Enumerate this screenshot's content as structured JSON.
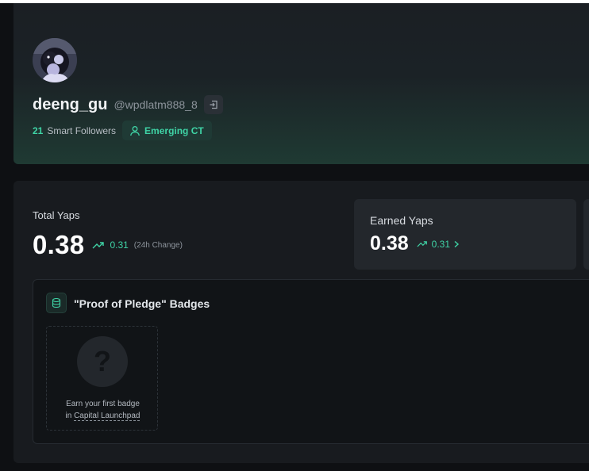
{
  "profile": {
    "display_name": "deeng_gu",
    "handle": "@wpdlatm888_8",
    "smart_followers_count": "21",
    "smart_followers_label": "Smart Followers",
    "tier_badge": "Emerging CT",
    "icons": {
      "exit": "sign-in-icon",
      "tier": "user-icon"
    }
  },
  "yaps": {
    "total_label": "Total Yaps",
    "total_value": "0.38",
    "total_change": "0.31",
    "total_change_note": "(24h Change)",
    "earned_label": "Earned Yaps",
    "earned_value": "0.38",
    "earned_change": "0.31",
    "icons": {
      "trend": "trending-up-icon",
      "more": "chevron-right-icon"
    }
  },
  "badges": {
    "title": "\"Proof of Pledge\" Badges",
    "empty_symbol": "?",
    "empty_line1": "Earn your first badge",
    "empty_line2_prefix": "in",
    "empty_link": "Capital Launchpad",
    "icons": {
      "header": "coin-stack-icon"
    }
  },
  "colors": {
    "accent": "#3fd4a6",
    "page_bg": "#0e1013",
    "card_bg": "#181b1f"
  }
}
